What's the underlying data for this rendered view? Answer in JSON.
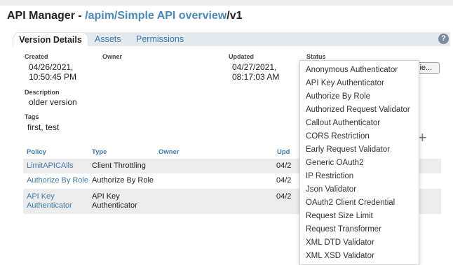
{
  "page": {
    "title_prefix": "API Manager - ",
    "title_path": "/apim/Simple API overview",
    "title_version": "/v1"
  },
  "tabs": [
    {
      "label": "Version Details"
    },
    {
      "label": "Assets"
    },
    {
      "label": "Permissions"
    }
  ],
  "help_glyph": "?",
  "details": {
    "created_label": "Created",
    "created_line1": "04/26/2021,",
    "created_line2": "10:50:45 PM",
    "owner_label": "Owner",
    "updated_label": "Updated",
    "updated_line1": "04/27/2021,",
    "updated_line2": "08:17:03 AM",
    "status_label": "Status",
    "description_label": "Description",
    "description_value": "older version",
    "tags_label": "Tags",
    "tags_value": "first, test",
    "partial_button": "lie..."
  },
  "add_glyph": "+",
  "table": {
    "headers": {
      "policy": "Policy",
      "type": "Type",
      "owner": "Owner",
      "updated": "Upd"
    },
    "rows": [
      {
        "policy": "LimitAPICAlls",
        "type": "Client Throttling",
        "updated": "04/2"
      },
      {
        "policy": "Authorize By Role",
        "type": "Authorize By Role",
        "updated": "04/2"
      },
      {
        "policy_line1": "API Key",
        "policy_line2": "Authenticator",
        "type_line1": "API Key",
        "type_line2": "Authenticator",
        "updated": "04/2"
      }
    ]
  },
  "dropdown": {
    "options": [
      "Anonymous Authenticator",
      "API Key Authenticator",
      "Authorize By Role",
      "Authorized Request Validator",
      "Callout Authenticator",
      "CORS Restriction",
      "Early Request Validator",
      "Generic OAuth2",
      "IP Restriction",
      "Json Validator",
      "OAuth2 Client Credential",
      "Request Size Limit",
      "Request Transformer",
      "XML DTD Validator",
      "XML XSD Validator"
    ]
  }
}
